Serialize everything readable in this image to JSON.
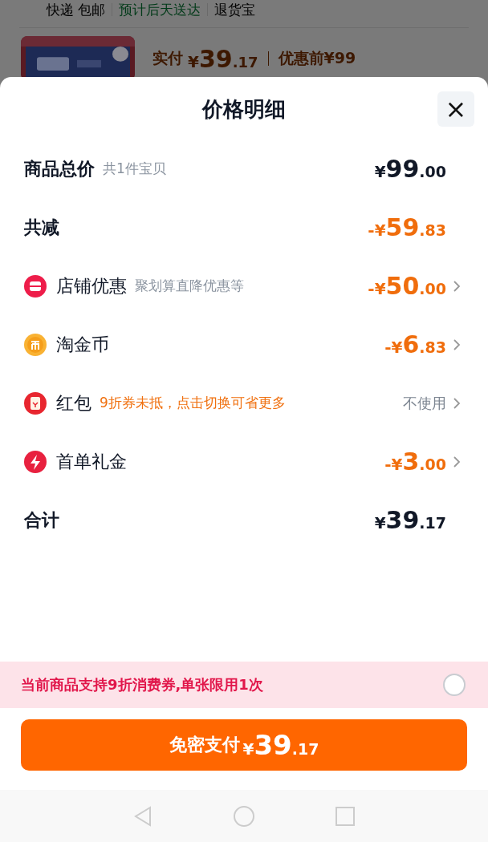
{
  "background_page": {
    "delivery": [
      {
        "text": "快递 包邮",
        "kind": "plain"
      },
      {
        "text": "预计后天送达",
        "kind": "green"
      },
      {
        "text": "退货宝",
        "kind": "plain"
      }
    ],
    "product": {
      "paid_label": "实付",
      "paid_amount": "¥39.17",
      "original_price": "优惠前¥99"
    }
  },
  "sheet": {
    "title": "价格明细",
    "close": "×"
  },
  "rows": [
    {
      "kind": "sum",
      "label": "商品总价",
      "note": "共1件宝贝",
      "amount": "¥99.00",
      "chevron": false
    },
    {
      "kind": "reduction",
      "label": "共减",
      "amount": "-¥59.83",
      "chevron": false
    },
    {
      "kind": "discount",
      "label": "店铺优惠",
      "note": "聚划算直降优惠等",
      "amount": "-¥50.00",
      "chevron": true
    },
    {
      "kind": "discount",
      "label": "淘金币",
      "amount": "-¥6.83",
      "chevron": true
    },
    {
      "kind": "option",
      "label": "红包",
      "note": "9折券未抵，点击切换可省更多",
      "action": "不使用",
      "chevron": true
    },
    {
      "kind": "discount",
      "label": "首单礼金",
      "amount": "-¥3.00",
      "chevron": true
    },
    {
      "kind": "sum",
      "label": "合计",
      "amount": "¥39.17",
      "chevron": false
    }
  ],
  "coupon_banner": {
    "text": "当前商品支持9折消费券,单张限用1次",
    "checked": false
  },
  "pay_button": {
    "label": "免密支付",
    "amount": "¥39.17"
  }
}
